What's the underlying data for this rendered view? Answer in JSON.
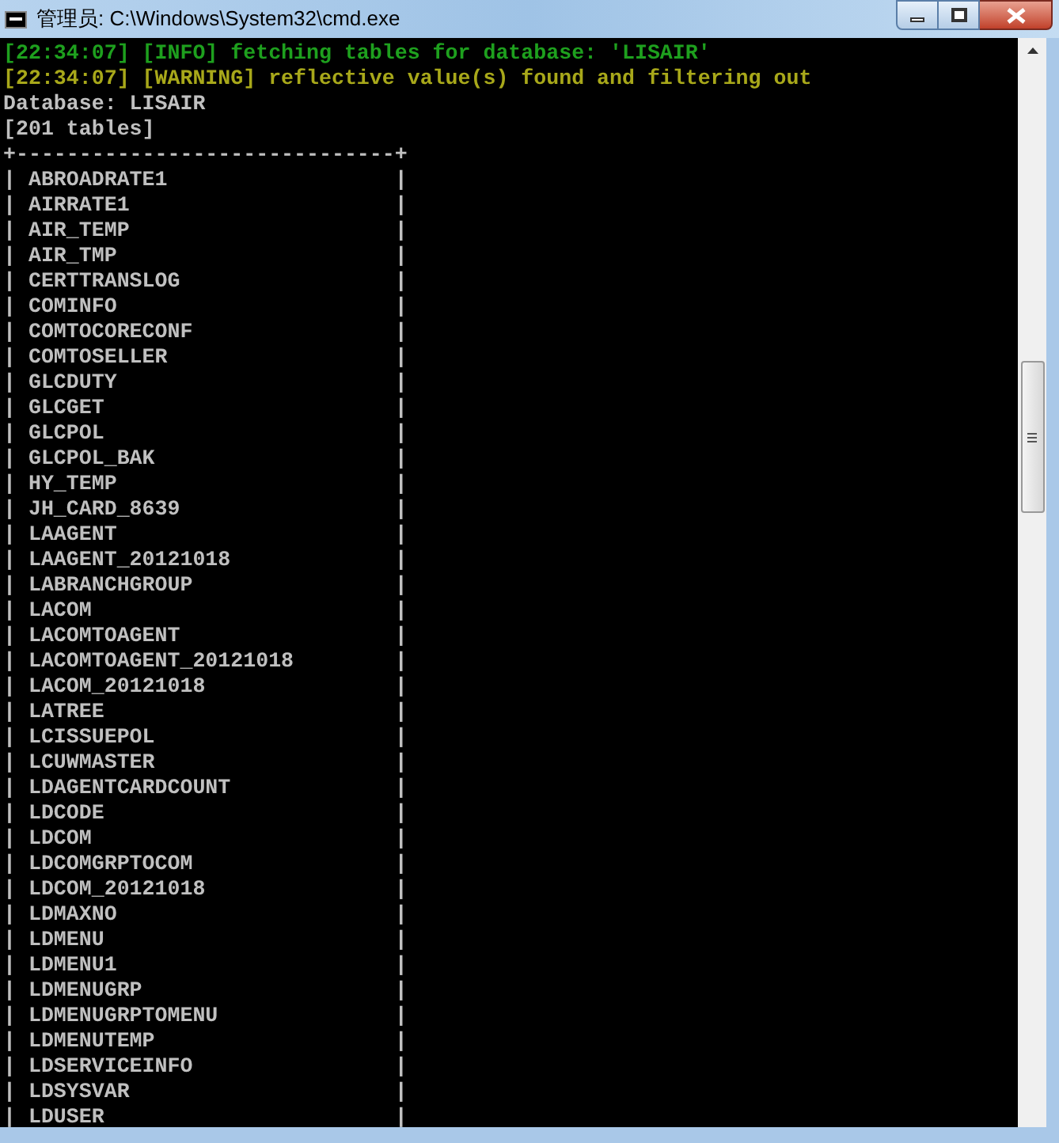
{
  "window": {
    "title": "管理员: C:\\Windows\\System32\\cmd.exe"
  },
  "console": {
    "lines": [
      {
        "kind": "info",
        "text": "[22:34:07] [INFO] fetching tables for database: 'LISAIR'"
      },
      {
        "kind": "warning",
        "text": "[22:34:07] [WARNING] reflective value(s) found and filtering out"
      },
      {
        "kind": "plain",
        "text": "Database: LISAIR"
      },
      {
        "kind": "plain",
        "text": "[201 tables]"
      },
      {
        "kind": "plain",
        "text": "+------------------------------+"
      },
      {
        "kind": "plain",
        "text": "| ABROADRATE1                  |"
      },
      {
        "kind": "plain",
        "text": "| AIRRATE1                     |"
      },
      {
        "kind": "plain",
        "text": "| AIR_TEMP                     |"
      },
      {
        "kind": "plain",
        "text": "| AIR_TMP                      |"
      },
      {
        "kind": "plain",
        "text": "| CERTTRANSLOG                 |"
      },
      {
        "kind": "plain",
        "text": "| COMINFO                      |"
      },
      {
        "kind": "plain",
        "text": "| COMTOCORECONF                |"
      },
      {
        "kind": "plain",
        "text": "| COMTOSELLER                  |"
      },
      {
        "kind": "plain",
        "text": "| GLCDUTY                      |"
      },
      {
        "kind": "plain",
        "text": "| GLCGET                       |"
      },
      {
        "kind": "plain",
        "text": "| GLCPOL                       |"
      },
      {
        "kind": "plain",
        "text": "| GLCPOL_BAK                   |"
      },
      {
        "kind": "plain",
        "text": "| HY_TEMP                      |"
      },
      {
        "kind": "plain",
        "text": "| JH_CARD_8639                 |"
      },
      {
        "kind": "plain",
        "text": "| LAAGENT                      |"
      },
      {
        "kind": "plain",
        "text": "| LAAGENT_20121018             |"
      },
      {
        "kind": "plain",
        "text": "| LABRANCHGROUP                |"
      },
      {
        "kind": "plain",
        "text": "| LACOM                        |"
      },
      {
        "kind": "plain",
        "text": "| LACOMTOAGENT                 |"
      },
      {
        "kind": "plain",
        "text": "| LACOMTOAGENT_20121018        |"
      },
      {
        "kind": "plain",
        "text": "| LACOM_20121018               |"
      },
      {
        "kind": "plain",
        "text": "| LATREE                       |"
      },
      {
        "kind": "plain",
        "text": "| LCISSUEPOL                   |"
      },
      {
        "kind": "plain",
        "text": "| LCUWMASTER                   |"
      },
      {
        "kind": "plain",
        "text": "| LDAGENTCARDCOUNT             |"
      },
      {
        "kind": "plain",
        "text": "| LDCODE                       |"
      },
      {
        "kind": "plain",
        "text": "| LDCOM                        |"
      },
      {
        "kind": "plain",
        "text": "| LDCOMGRPTOCOM                |"
      },
      {
        "kind": "plain",
        "text": "| LDCOM_20121018               |"
      },
      {
        "kind": "plain",
        "text": "| LDMAXNO                      |"
      },
      {
        "kind": "plain",
        "text": "| LDMENU                       |"
      },
      {
        "kind": "plain",
        "text": "| LDMENU1                      |"
      },
      {
        "kind": "plain",
        "text": "| LDMENUGRP                    |"
      },
      {
        "kind": "plain",
        "text": "| LDMENUGRPTOMENU              |"
      },
      {
        "kind": "plain",
        "text": "| LDMENUTEMP                   |"
      },
      {
        "kind": "plain",
        "text": "| LDSERVICEINFO                |"
      },
      {
        "kind": "plain",
        "text": "| LDSYSVAR                     |"
      },
      {
        "kind": "plain",
        "text": "| LDUSER                       |"
      }
    ]
  }
}
